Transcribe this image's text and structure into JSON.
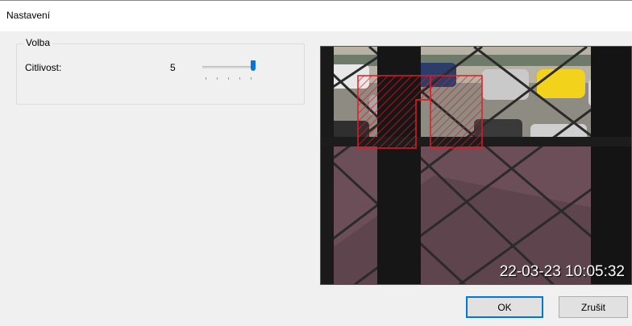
{
  "window": {
    "title": "Nastavení"
  },
  "group": {
    "legend": "Volba",
    "sensitivity": {
      "label": "Citlivost:",
      "value": "5",
      "fraction": 1.0
    }
  },
  "camera": {
    "timestamp": "22-03-23 10:05:32"
  },
  "buttons": {
    "ok": "OK",
    "cancel": "Zrušit"
  },
  "colors": {
    "accent": "#0a74d8",
    "zone": "#e01b22"
  }
}
